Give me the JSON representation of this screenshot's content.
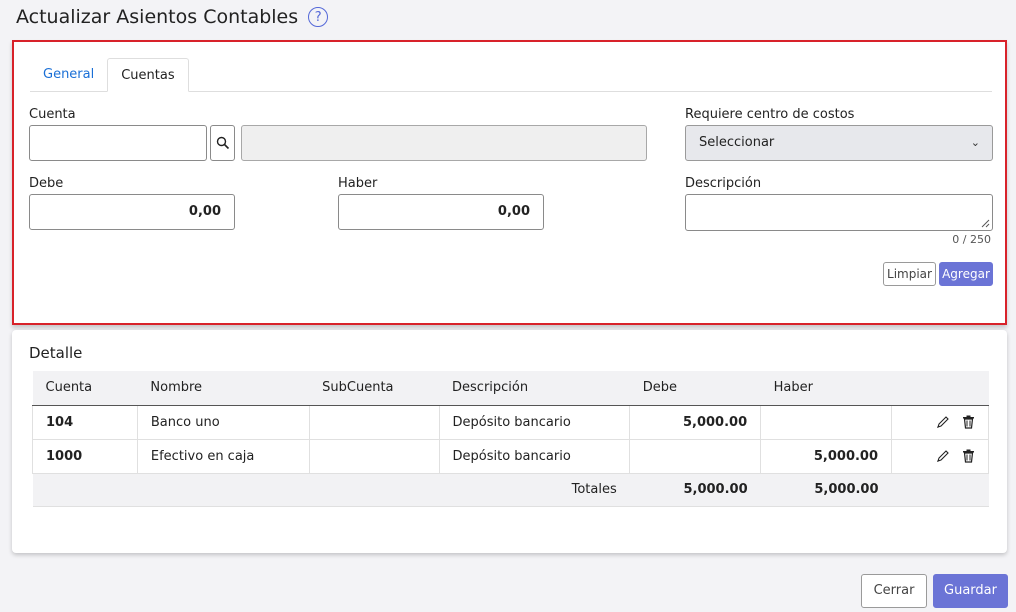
{
  "header": {
    "title": "Actualizar Asientos Contables",
    "help_icon": "question-circle-icon"
  },
  "tabs": [
    {
      "label": "General"
    },
    {
      "label": "Cuentas"
    }
  ],
  "form": {
    "cuenta_label": "Cuenta",
    "cuenta_value": "",
    "cuenta_name_value": "",
    "centro_costos_label": "Requiere centro de costos",
    "centro_costos_value": "Seleccionar",
    "debe_label": "Debe",
    "debe_value": "0,00",
    "haber_label": "Haber",
    "haber_value": "0,00",
    "descripcion_label": "Descripción",
    "descripcion_value": "",
    "descripcion_counter": "0 / 250",
    "limpiar_label": "Limpiar",
    "agregar_label": "Agregar"
  },
  "detalle": {
    "title": "Detalle",
    "columns": [
      "Cuenta",
      "Nombre",
      "SubCuenta",
      "Descripción",
      "Debe",
      "Haber"
    ],
    "rows": [
      {
        "cuenta": "104",
        "nombre": "Banco uno",
        "subcuenta": "",
        "descripcion": "Depósito bancario",
        "debe": "5,000.00",
        "haber": ""
      },
      {
        "cuenta": "1000",
        "nombre": "Efectivo en caja",
        "subcuenta": "",
        "descripcion": "Depósito bancario",
        "debe": "",
        "haber": "5,000.00"
      }
    ],
    "totales_label": "Totales",
    "total_debe": "5,000.00",
    "total_haber": "5,000.00"
  },
  "footer": {
    "cerrar_label": "Cerrar",
    "guardar_label": "Guardar"
  },
  "colors": {
    "accent": "#6b74d6",
    "highlight_border": "#d8222a",
    "tab_active": "#1a6fd6"
  }
}
